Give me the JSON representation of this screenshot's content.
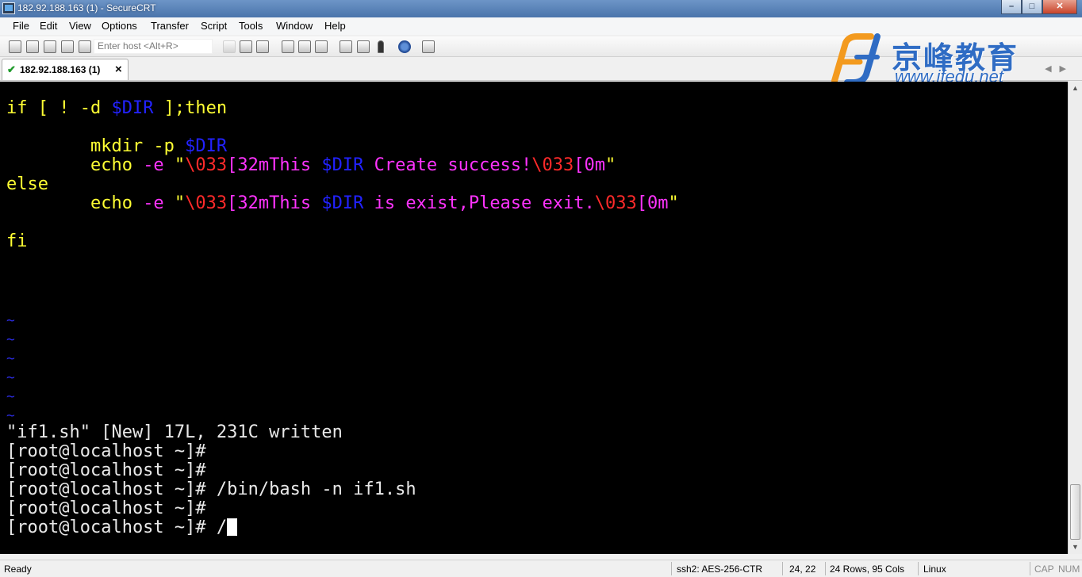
{
  "window": {
    "title": "182.92.188.163 (1) - SecureCRT"
  },
  "menu": [
    "File",
    "Edit",
    "View",
    "Options",
    "Transfer",
    "Script",
    "Tools",
    "Window",
    "Help"
  ],
  "toolbar": {
    "host_placeholder": "Enter host <Alt+R>"
  },
  "tab": {
    "label": "182.92.188.163 (1)"
  },
  "logo": {
    "chinese": "京峰教育",
    "url": "www.jfedu.net"
  },
  "terminal": {
    "line1": {
      "a": "if [ ! -d ",
      "b": "$DIR",
      "c": " ];then"
    },
    "line2": {
      "a": "        mkdir -p ",
      "b": "$DIR"
    },
    "line3": {
      "a": "        echo ",
      "b": "-e",
      "c": " \"",
      "d": "\\033",
      "e": "[32mThis ",
      "f": "$DIR",
      "g": " Create success!",
      "h": "\\033",
      "i": "[0m",
      "j": "\""
    },
    "line4": {
      "a": "else"
    },
    "line5": {
      "a": "        echo ",
      "b": "-e",
      "c": " \"",
      "d": "\\033",
      "e": "[32mThis ",
      "f": "$DIR",
      "g": " is exist,Please exit.",
      "h": "\\033",
      "i": "[0m",
      "j": "\""
    },
    "line6": {
      "a": "fi"
    },
    "tilde": "~",
    "written": "\"if1.sh\" [New] 17L, 231C written",
    "prompt": "[root@localhost ~]#",
    "cmd1": " /bin/bash -n if1.sh",
    "cmd_current": " /"
  },
  "status": {
    "ready": "Ready",
    "cipher": "ssh2: AES-256-CTR",
    "position": "24,  22",
    "size": "24 Rows, 95 Cols",
    "os": "Linux",
    "cap": "CAP",
    "num": "NUM"
  }
}
